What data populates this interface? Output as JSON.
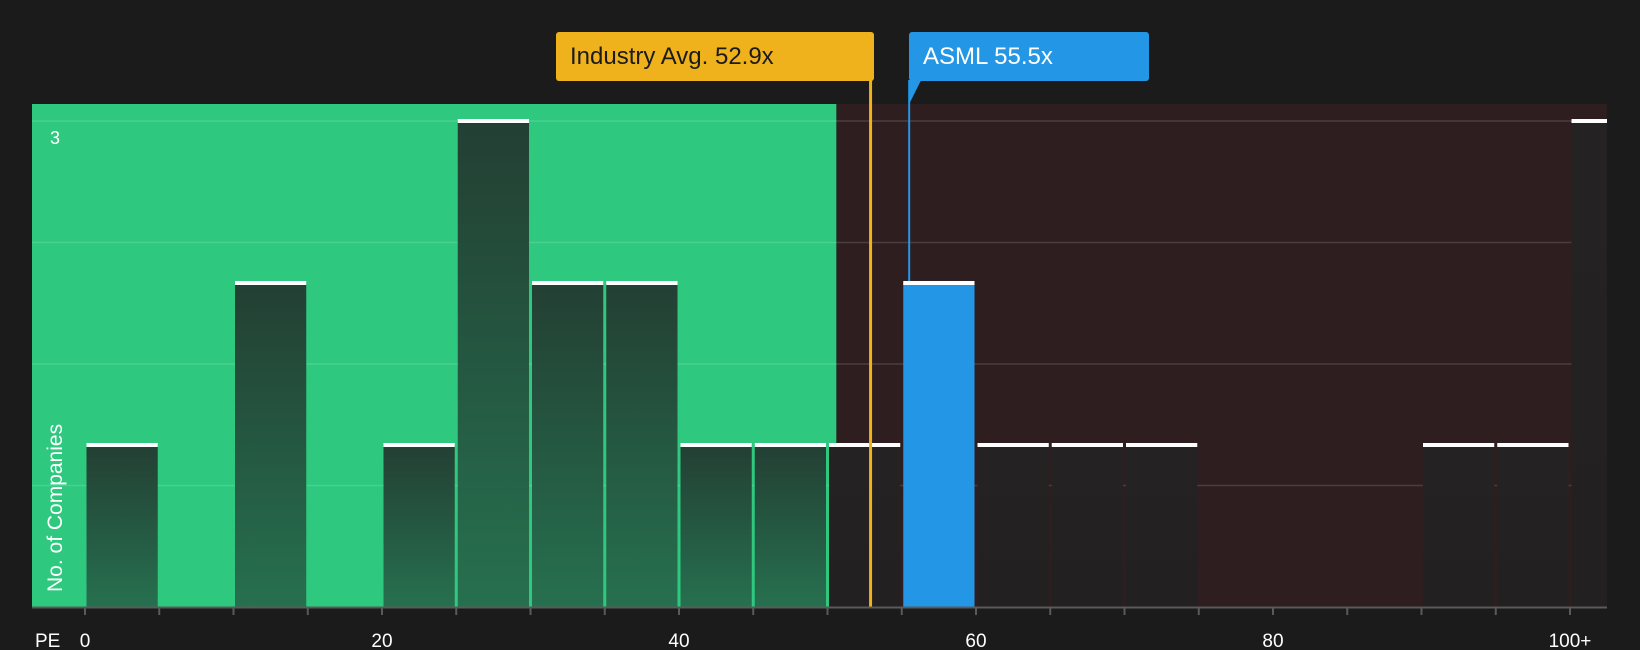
{
  "chart_data": {
    "type": "bar",
    "xlabel": "PE",
    "ylabel": "No. of Companies",
    "x_ticks": [
      "0",
      "20",
      "40",
      "60",
      "80",
      "100+"
    ],
    "y_ticks": [
      "3"
    ],
    "xlim": [
      0,
      100
    ],
    "ylim": [
      0,
      3
    ],
    "bin_width": 5,
    "bins": [
      {
        "start": 0,
        "count": 1
      },
      {
        "start": 10,
        "count": 2
      },
      {
        "start": 20,
        "count": 1
      },
      {
        "start": 25,
        "count": 3
      },
      {
        "start": 30,
        "count": 2
      },
      {
        "start": 35,
        "count": 2
      },
      {
        "start": 40,
        "count": 1
      },
      {
        "start": 45,
        "count": 1
      },
      {
        "start": 50,
        "count": 1
      },
      {
        "start": 55,
        "count": 2,
        "highlight": true
      },
      {
        "start": 60,
        "count": 1
      },
      {
        "start": 65,
        "count": 1
      },
      {
        "start": 70,
        "count": 1
      },
      {
        "start": 90,
        "count": 1
      },
      {
        "start": 95,
        "count": 1
      },
      {
        "start": 100,
        "count": 3
      }
    ],
    "good_value_limit": 50.6,
    "industry_average": {
      "label": "Industry Avg. 52.9x",
      "value": 52.9
    },
    "company": {
      "label": "ASML 55.5x",
      "value": 55.5
    },
    "grid": true,
    "colors": {
      "background": "#1b1b1b",
      "undervalued_zone": "#2ec97f",
      "overvalued_zone": "#2e1e20",
      "bar": "#23473a",
      "company_bar": "#2496e6",
      "industry_line": "#efb21d",
      "bar_cap": "#ffffff"
    }
  }
}
